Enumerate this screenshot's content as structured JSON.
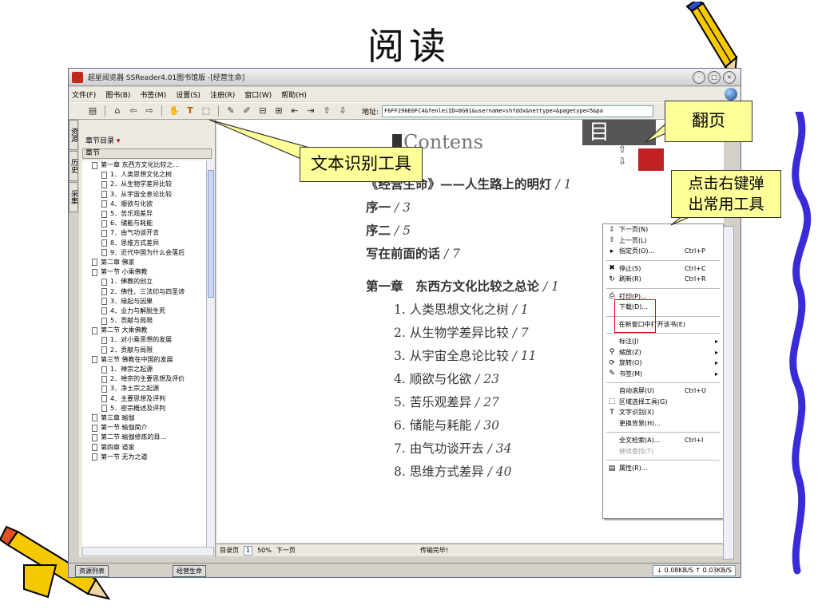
{
  "slide": {
    "title": "阅读"
  },
  "window": {
    "title": "超星阅览器 SSReader4.01图书馆版 -[经营生命]",
    "controls": [
      "–",
      "□",
      "×"
    ]
  },
  "menubar": [
    "文件(F)",
    "图书(B)",
    "书签(M)",
    "设置(S)",
    "注册(R)",
    "窗口(W)",
    "帮助(H)"
  ],
  "toolbar": {
    "address_label": "地址:",
    "address_value": "F6FF296E0FC4&fenleiID=0G01&username=shfddx&nettype=&pagetype=5&pa"
  },
  "vertical_tabs": [
    "资源",
    "历史",
    "采集"
  ],
  "left_panel": {
    "header": "章节目录",
    "column": "章节",
    "items": [
      "第一章 东西方文化比较之...",
      "1．人类思想文化之树",
      "2．从生物学差异比较",
      "3．从宇宙全息论比较",
      "4．顺欲与化欲",
      "5．苦乐观差异",
      "6．储能与耗能",
      "7．由气功谈开去",
      "8．思维方式差异",
      "9．近代中国为什么会落后",
      "第二章 佛家",
      "第一节 小乘佛教",
      "1．佛教的创立",
      "2．佛性、三法印与四圣谛",
      "3．缘起与因果",
      "4．业力与解脱生死",
      "5．贡献与局限",
      "第二节 大乘佛教",
      "1．对小乘思想的发展",
      "2．贡献与局限",
      "第三节 佛教在中国的发展",
      "1．禅宗之起源",
      "2．禅宗的主要思想及评价",
      "3．净土宗之起源",
      "4．主要思想及评判",
      "5．密宗概述及评判",
      "第三章 瑜伽",
      "第一节 瑜伽简介",
      "第二节 瑜伽修炼的目...",
      "第四章 道家",
      "第一节 无为之道"
    ]
  },
  "reader": {
    "heading": "Contens",
    "toc": [
      {
        "bold": "《经营生命》——人生路上的明灯",
        "page": " / 1"
      },
      {
        "bold": "序一",
        "page": " / 3"
      },
      {
        "bold": "序二",
        "page": " / 5"
      },
      {
        "bold": "写在前面的话",
        "page": " / 7"
      },
      {
        "bold": "第一章　东西方文化比较之总论",
        "page": " / 1"
      },
      {
        "text": "1. 人类思想文化之树",
        "page": " / 1"
      },
      {
        "text": "2. 从生物学差异比较",
        "page": " / 7"
      },
      {
        "text": "3. 从宇宙全息论比较",
        "page": " / 11"
      },
      {
        "text": "4. 顺欲与化欲",
        "page": " / 23"
      },
      {
        "text": "5. 苦乐观差异",
        "page": " / 27"
      },
      {
        "text": "6. 储能与耗能",
        "page": " / 30"
      },
      {
        "text": "7. 由气功谈开去",
        "page": " / 34"
      },
      {
        "text": "8. 思维方式差异",
        "page": " / 40"
      }
    ]
  },
  "status": {
    "toc_page": "目录页",
    "page_num": "1",
    "zoom": "50%",
    "next": "下一页",
    "transfer": "传输完毕!"
  },
  "bottombar": {
    "resource_tab": "资源列表",
    "book_tab": "经营生命",
    "rate": "↓ 0.08KB/S  ↑ 0.03KB/S"
  },
  "context_menu": {
    "items": [
      {
        "icon": "⇩",
        "label": "下一页(N)",
        "shortcut": ""
      },
      {
        "icon": "⇧",
        "label": "上一页(L)",
        "shortcut": ""
      },
      {
        "icon": "▸",
        "label": "指定页(O)...",
        "shortcut": "Ctrl+P"
      },
      {
        "sep": true
      },
      {
        "icon": "✖",
        "label": "停止(S)",
        "shortcut": "Ctrl+C"
      },
      {
        "icon": "↻",
        "label": "刷新(R)",
        "shortcut": "Ctrl+R"
      },
      {
        "sep": true
      },
      {
        "icon": "⎙",
        "label": "打印(P)...",
        "shortcut": ""
      },
      {
        "icon": "",
        "label": "下载(D)...",
        "shortcut": ""
      },
      {
        "sep": true
      },
      {
        "icon": "",
        "label": "在新窗口中打开该书(E)",
        "shortcut": ""
      },
      {
        "sep": true
      },
      {
        "icon": "",
        "label": "标注(J)",
        "shortcut": "▸"
      },
      {
        "icon": "⚲",
        "label": "缩放(Z)",
        "shortcut": "▸"
      },
      {
        "icon": "⟳",
        "label": "旋转(O)",
        "shortcut": "▸"
      },
      {
        "icon": "✎",
        "label": "书签(M)",
        "shortcut": "▸"
      },
      {
        "sep": true
      },
      {
        "icon": "",
        "label": "自动滚屏(U)",
        "shortcut": "Ctrl+U"
      },
      {
        "icon": "⬚",
        "label": "区域选择工具(G)",
        "shortcut": ""
      },
      {
        "icon": "T",
        "label": "文字识别(X)",
        "shortcut": ""
      },
      {
        "icon": "",
        "label": "更换背景(H)...",
        "shortcut": ""
      },
      {
        "sep": true
      },
      {
        "icon": "",
        "label": "全文检索(A)...",
        "shortcut": "Ctrl+I"
      },
      {
        "icon": "",
        "label": "继续查找(T)",
        "shortcut": "",
        "disabled": true
      },
      {
        "sep": true
      },
      {
        "icon": "▤",
        "label": "属性(R)...",
        "shortcut": ""
      }
    ]
  },
  "callouts": {
    "ocr_tool": "文本识别工具",
    "page_turn": "翻页",
    "right_click": "点击右键弹出常用工具"
  }
}
